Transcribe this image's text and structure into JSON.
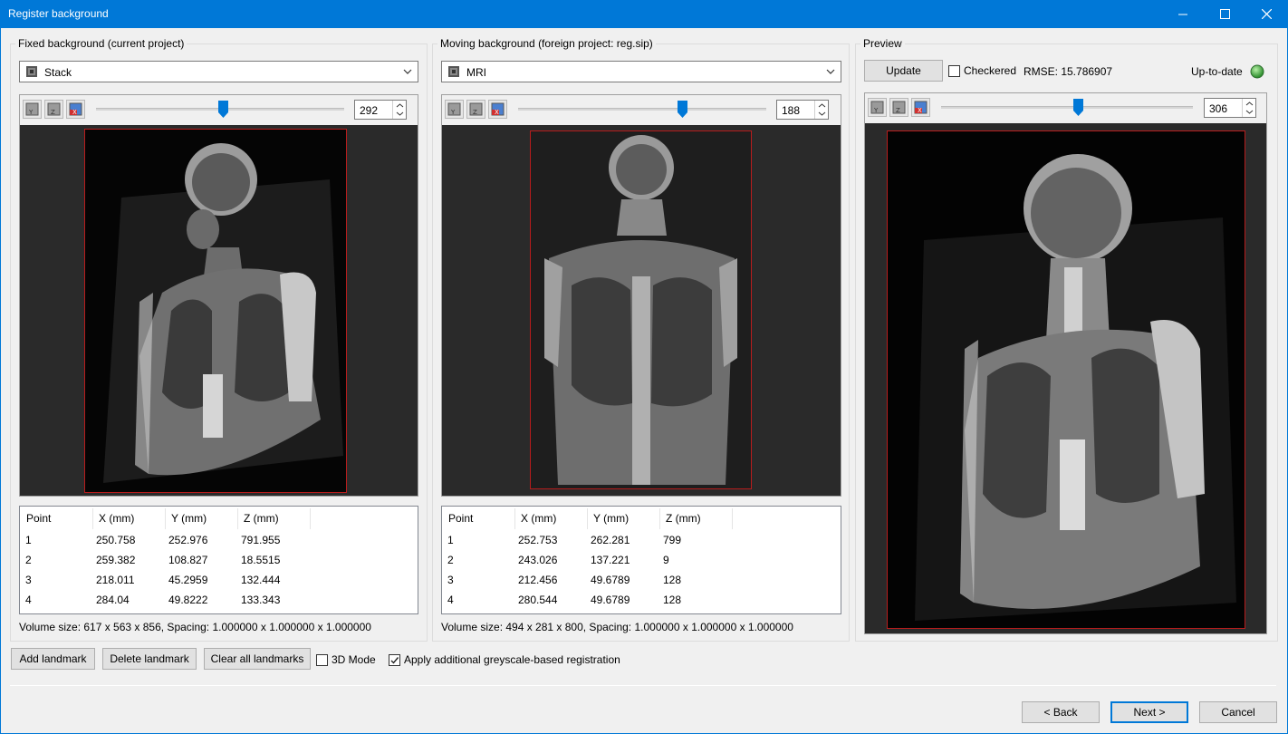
{
  "window": {
    "title": "Register background"
  },
  "fixed": {
    "group_title": "Fixed background (current project)",
    "combo_value": "Stack",
    "slice": "292",
    "slider_position": 0.52,
    "table": {
      "headers": [
        "Point",
        "X (mm)",
        "Y (mm)",
        "Z (mm)"
      ],
      "rows": [
        [
          "1",
          "250.758",
          "252.976",
          "791.955"
        ],
        [
          "2",
          "259.382",
          "108.827",
          "18.5515"
        ],
        [
          "3",
          "218.011",
          "45.2959",
          "132.444"
        ],
        [
          "4",
          "284.04",
          "49.8222",
          "133.343"
        ]
      ]
    },
    "info": "Volume size: 617 x 563 x 856, Spacing: 1.000000 x 1.000000 x 1.000000"
  },
  "moving": {
    "group_title": "Moving background (foreign project: reg.sip)",
    "combo_value": "MRI",
    "slice": "188",
    "slider_position": 0.66,
    "table": {
      "headers": [
        "Point",
        "X (mm)",
        "Y (mm)",
        "Z (mm)"
      ],
      "rows": [
        [
          "1",
          "252.753",
          "262.281",
          "799"
        ],
        [
          "2",
          "243.026",
          "137.221",
          "9"
        ],
        [
          "3",
          "212.456",
          "49.6789",
          "128"
        ],
        [
          "4",
          "280.544",
          "49.6789",
          "128"
        ]
      ]
    },
    "info": "Volume size: 494 x 281 x 800, Spacing: 1.000000 x 1.000000 x 1.000000"
  },
  "preview": {
    "group_title": "Preview",
    "update_label": "Update",
    "checkered_label": "Checkered",
    "checkered_checked": false,
    "rmse": "RMSE: 15.786907",
    "status_label": "Up-to-date",
    "status_color": "#4caf50",
    "slice": "306",
    "slider_position": 0.54
  },
  "actions": {
    "add_landmark": "Add landmark",
    "delete_landmark": "Delete landmark",
    "clear_all": "Clear all landmarks",
    "mode3d_label": "3D Mode",
    "mode3d_checked": false,
    "greyscale_label": "Apply additional greyscale-based registration",
    "greyscale_checked": true
  },
  "footer": {
    "back": "< Back",
    "next": "Next >",
    "cancel": "Cancel"
  },
  "colors": {
    "titlebar": "#0078d7",
    "outline": "#b81c1c",
    "viewer_bg": "#2a2a2a"
  },
  "icons": [
    "minimize-icon",
    "maximize-icon",
    "close-icon",
    "image-stack-icon",
    "flip-y-icon",
    "flip-z-icon",
    "flip-x-icon",
    "dropdown-arrow-icon",
    "status-led-icon"
  ]
}
